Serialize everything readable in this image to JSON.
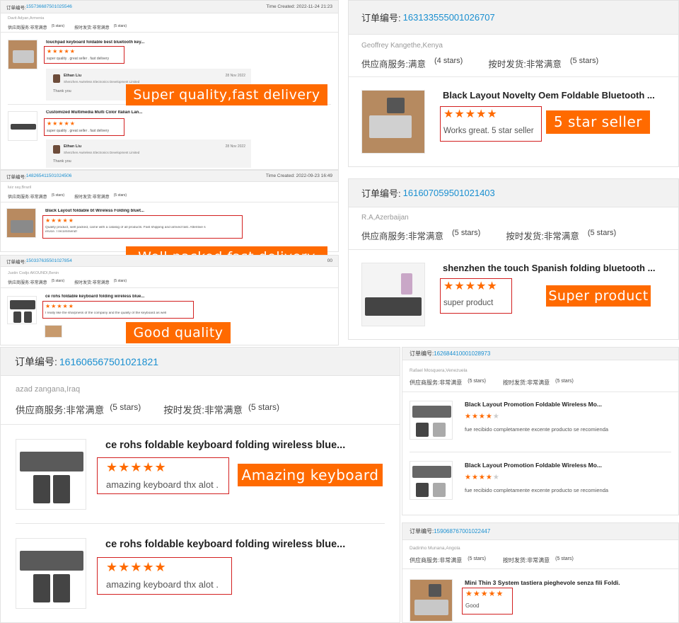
{
  "p1": {
    "order_label": "订单编号:",
    "order_id": "155736687501025546",
    "time_created": "Time Created: 2022-11-24 21:23",
    "buyer": "Davit Adyan,Armenia",
    "svc_label": "供应商服务:",
    "svc_value": "非常满意",
    "svc_stars": "(5 stars)",
    "ship_label": "按时发货:",
    "ship_value": "非常满意",
    "ship_stars": "(5 stars)",
    "item1": {
      "title": "touchpad keyboard foldable best bluetooth key...",
      "stars": "★★★★★",
      "comment": "super quality . great seller . fast delivery"
    },
    "reply1": {
      "name": "Ethan Liu",
      "company": "Shenzhen Awireless Electronics Development Limited",
      "date": "28 Nov 2022",
      "text": "Thank you"
    },
    "item2": {
      "title": "Customized Multimedia Multi Color Italian Lan...",
      "stars": "★★★★★",
      "comment": "super quality . great seller . fast delivery"
    },
    "reply2": {
      "name": "Ethan Liu",
      "company": "Shenzhen Awireless Electronics Development Limited",
      "date": "28 Nov 2022",
      "text": "Thank you"
    },
    "badge": "Super quality,fast delivery"
  },
  "p2": {
    "order_label": "订单编号:",
    "order_id": "148265411501024506",
    "time_created": "Time Created: 2022-09-23 16:49",
    "buyer": "luiz say,Brazil",
    "svc_label": "供应商服务:",
    "svc_value": "非常满意",
    "svc_stars": "(5 stars)",
    "ship_label": "按时发货:",
    "ship_value": "非常满意",
    "ship_stars": "(5 stars)",
    "item1": {
      "title": "Black Layout foldable bt Wireless Folding bluet...",
      "stars": "★★★★★",
      "comment": "Quality product, well packed, came with a catalog of all products. Fast shipping and arrived fast. Attentive s",
      "comment2": "ervice. I recommend!"
    },
    "badge": "Well packed,fast delivery"
  },
  "p3": {
    "order_label": "订单编号:",
    "order_id": "150337635501027854",
    "time_fragment": "00",
    "buyer": "Justin Codjo AKOUNDI,Benin",
    "svc_label": "供应商服务:",
    "svc_value": "非常满意",
    "svc_stars": "(5 stars)",
    "ship_label": "按时发货:",
    "ship_value": "非常满意",
    "ship_stars": "(5 stars)",
    "item1": {
      "title": "ce rohs foldable keyboard folding wireless blue...",
      "stars": "★★★★★",
      "comment": "I really like the sharpness of the company and the quality of the keyboard as well"
    },
    "badge": "Good quality"
  },
  "p4": {
    "order_label": "订单编号:",
    "order_id": "163133555001026707",
    "buyer": "Geoffrey Kangethe,Kenya",
    "svc_label": "供应商服务:",
    "svc_value": "满意",
    "svc_stars": "(4 stars)",
    "ship_label": "按时发货:",
    "ship_value": "非常满意",
    "ship_stars": "(5 stars)",
    "item1": {
      "title": "Black Layout Novelty Oem Foldable Bluetooth ...",
      "stars": "★★★★★",
      "comment": "Works great. 5 star seller"
    },
    "badge": "5 star seller"
  },
  "p5": {
    "order_label": "订单编号:",
    "order_id": "161607059501021403",
    "buyer": "R.A,Azerbaijan",
    "svc_label": "供应商服务:",
    "svc_value": "非常满意",
    "svc_stars": "(5 stars)",
    "ship_label": "按时发货:",
    "ship_value": "非常满意",
    "ship_stars": "(5 stars)",
    "item1": {
      "title": "shenzhen the touch Spanish folding bluetooth ...",
      "stars": "★★★★★",
      "comment": "super product"
    },
    "badge": "Super product"
  },
  "p6": {
    "order_label": "订单编号:",
    "order_id": "161606567501021821",
    "buyer": "azad zangana,Iraq",
    "svc_label": "供应商服务:",
    "svc_value": "非常满意",
    "svc_stars": "(5 stars)",
    "ship_label": "按时发货:",
    "ship_value": "非常满意",
    "ship_stars": "(5 stars)",
    "item1": {
      "title": "ce rohs foldable keyboard folding wireless blue...",
      "stars": "★★★★★",
      "comment": "amazing keyboard thx alot ."
    },
    "item2": {
      "title": "ce rohs foldable keyboard folding wireless blue...",
      "stars": "★★★★★",
      "comment": "amazing keyboard thx alot ."
    },
    "badge": "Amazing keyboard"
  },
  "p7": {
    "order_label": "订单编号:",
    "order_id": "162684410001028973",
    "buyer": "Rafael Mosquera,Venezuela",
    "svc_label": "供应商服务:",
    "svc_value": "非常满意",
    "svc_stars": "(5 stars)",
    "ship_label": "按时发货:",
    "ship_value": "非常满意",
    "ship_stars": "(5 stars)",
    "item1": {
      "title": "Black Layout Promotion Foldable Wireless Mo...",
      "stars_on": "★★★★",
      "stars_off": "★",
      "comment": "fue recibido completamente excente producto se recomienda"
    },
    "item2": {
      "title": "Black Layout Promotion Foldable Wireless Mo...",
      "stars_on": "★★★★",
      "stars_off": "★",
      "comment": "fue recibido completamente excente producto se recomienda"
    }
  },
  "p8": {
    "order_label": "订单编号:",
    "order_id": "159068767001022447",
    "buyer": "Dadinho Munana,Angola",
    "svc_label": "供应商服务:",
    "svc_value": "非常满意",
    "svc_stars": "(5 stars)",
    "ship_label": "按时发货:",
    "ship_value": "非常满意",
    "ship_stars": "(5 stars)",
    "item1": {
      "title": "Mini Thin 3 System tastiera pieghevole senza fili Foldi...",
      "stars": "★★★★★",
      "comment": "Good"
    }
  },
  "colors": {
    "accent": "#ff6a00",
    "link": "#1a8fd0",
    "highlight_border": "#d32020"
  }
}
